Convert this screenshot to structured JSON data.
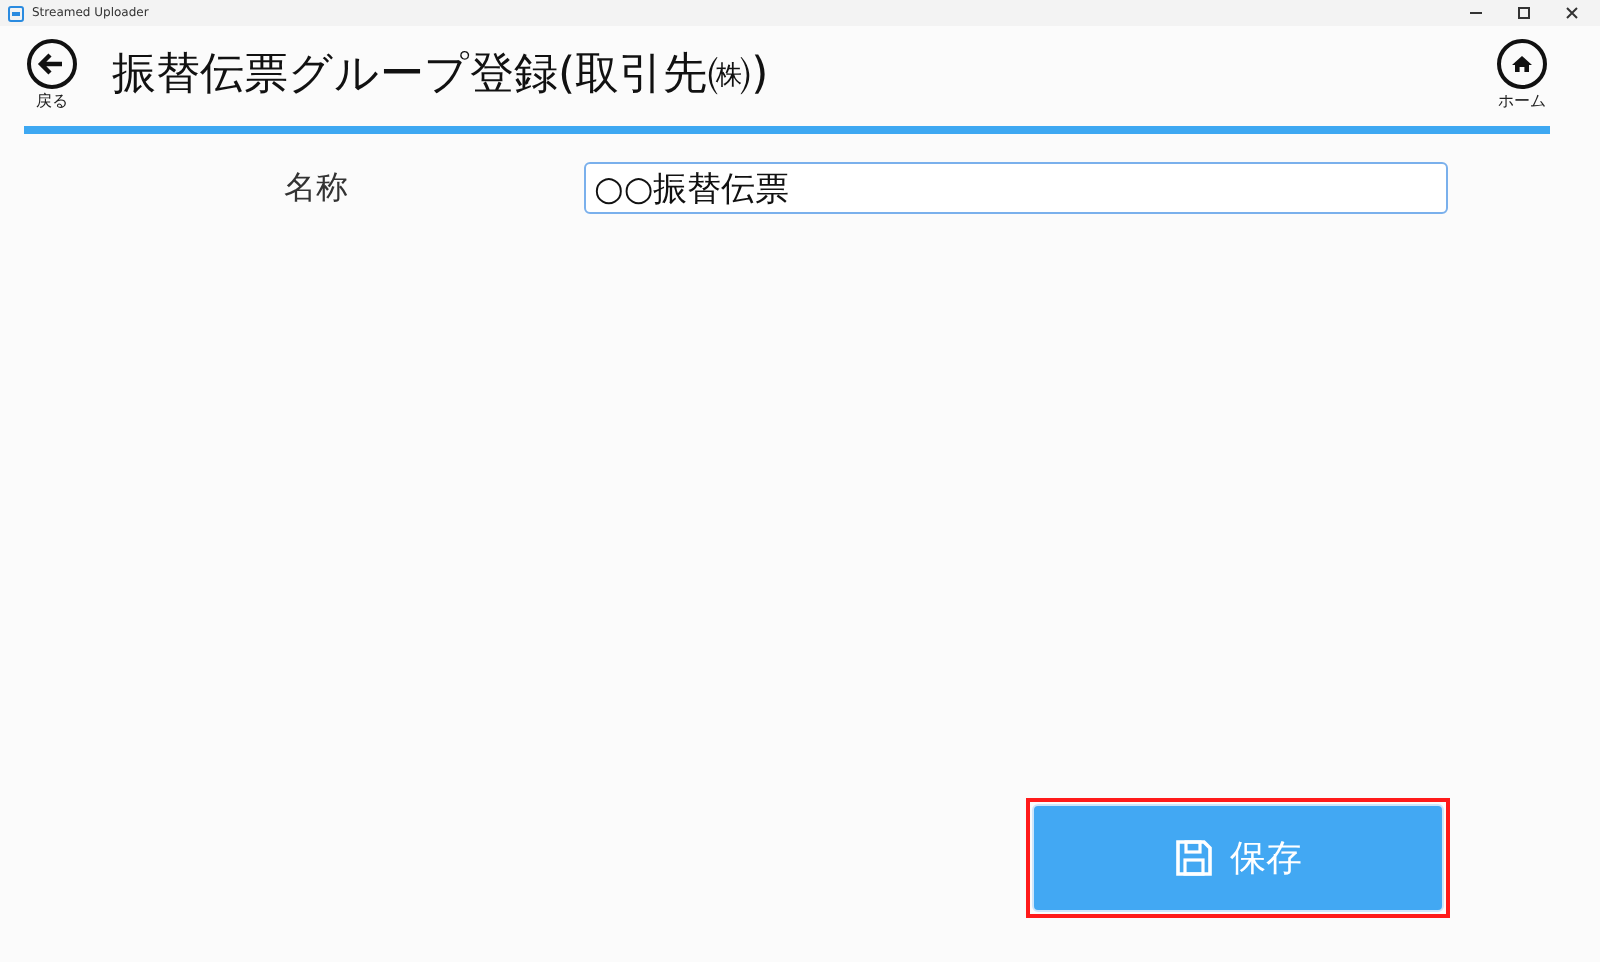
{
  "window": {
    "title": "Streamed Uploader"
  },
  "header": {
    "back_label": "戻る",
    "title": "振替伝票グループ登録(取引先㈱)",
    "home_label": "ホーム"
  },
  "form": {
    "fields": [
      {
        "label": "名称",
        "value": "○○振替伝票",
        "focused": true
      }
    ]
  },
  "save_button": {
    "label": "保存",
    "highlighted": true
  }
}
